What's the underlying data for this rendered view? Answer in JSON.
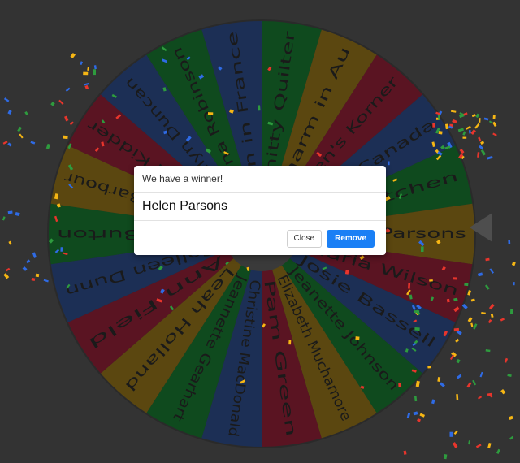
{
  "wheel": {
    "names": [
      "Lin in France",
      "Knitty Quilter",
      "Sharm in Au",
      "Karen's Korner",
      "Lis in Canada",
      "Jo's Kitchen",
      "Helen Parsons",
      "Maria Wilson",
      "Josie Bassell",
      "Jeanette Johnson",
      "Elizabeth Muchamore",
      "Pam Green",
      "Christine MacDonald",
      "Jeannette Gearhart",
      "Leah Holland",
      "Ann Field",
      "Colleen Dunn",
      "Linda Burton",
      "Sharon Barbour",
      "Sharon Kidder",
      "Marilyn Duncan",
      "Fiona Robinson"
    ],
    "colors": [
      "#1c2f55",
      "#0f4a1e",
      "#5b4710",
      "#5a1422"
    ],
    "background": "#333333",
    "pointer_color": "#4e4e4e",
    "text_color": "#1a1a1a"
  },
  "modal": {
    "title": "We have a winner!",
    "winner": "Helen Parsons",
    "close_label": "Close",
    "remove_label": "Remove"
  },
  "confetti_colors": [
    "#e8352c",
    "#f6b614",
    "#2e9b3e",
    "#2f6be5"
  ]
}
